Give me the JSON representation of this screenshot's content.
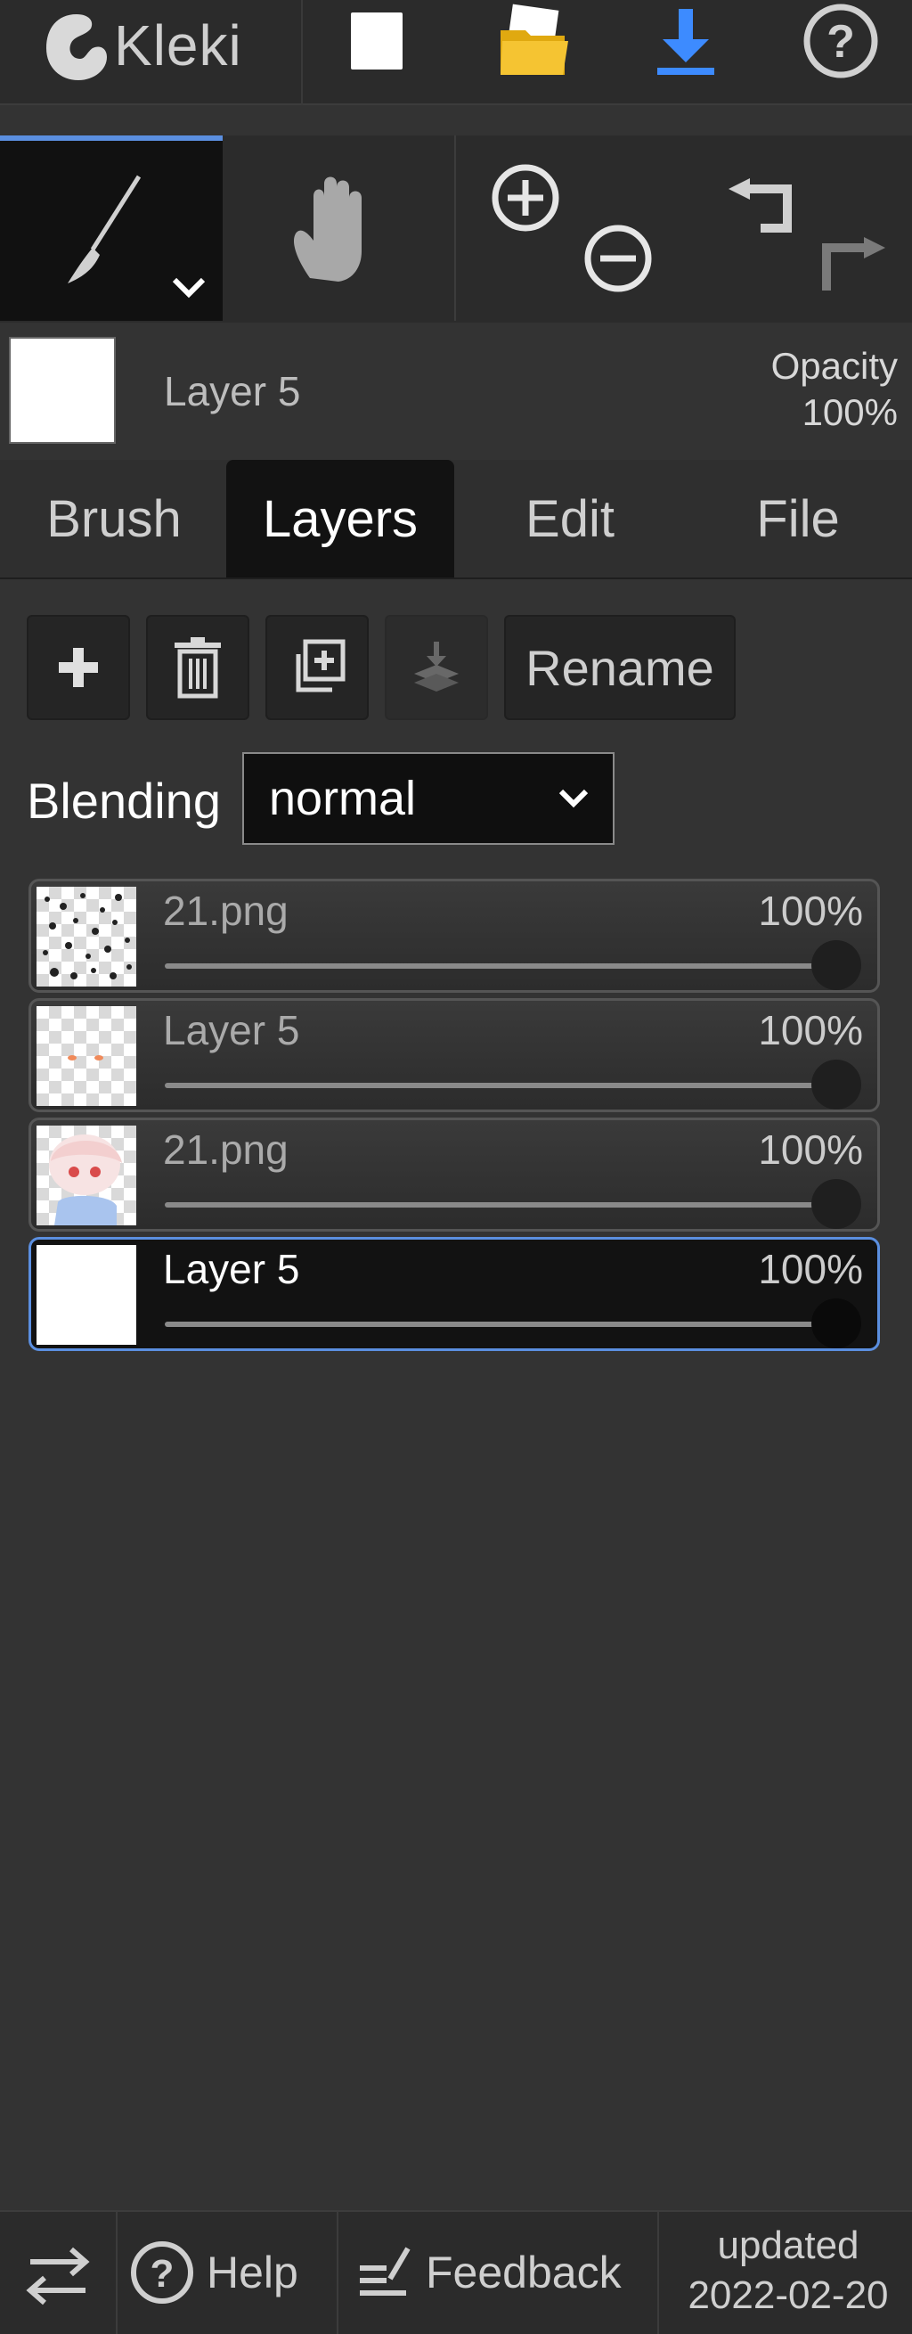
{
  "app": {
    "logo_text": "Kleki"
  },
  "preview": {
    "layer_name": "Layer 5",
    "opacity_label": "Opacity",
    "opacity_value": "100%"
  },
  "tabs": [
    "Brush",
    "Layers",
    "Edit",
    "File"
  ],
  "active_tab": "Layers",
  "layer_actions": {
    "rename_label": "Rename"
  },
  "blending": {
    "label": "Blending",
    "value": "normal"
  },
  "layers": [
    {
      "name": "21.png",
      "opacity": "100%",
      "selected": false
    },
    {
      "name": "Layer 5",
      "opacity": "100%",
      "selected": false
    },
    {
      "name": "21.png",
      "opacity": "100%",
      "selected": false
    },
    {
      "name": "Layer 5",
      "opacity": "100%",
      "selected": true
    }
  ],
  "bottom": {
    "help_label": "Help",
    "feedback_label": "Feedback",
    "updated_label": "updated",
    "updated_date": "2022-02-20"
  },
  "colors": {
    "accent": "#5b8fe0",
    "download": "#3d8bff",
    "folder": "#f2c230"
  },
  "icons": [
    "kleki-logo-icon",
    "new-image-icon",
    "open-folder-icon",
    "download-icon",
    "help-circle-icon",
    "brush-icon",
    "chevron-down-icon",
    "hand-icon",
    "zoom-in-icon",
    "zoom-out-icon",
    "undo-icon",
    "redo-icon",
    "plus-icon",
    "trash-icon",
    "duplicate-icon",
    "merge-down-icon",
    "swap-icon",
    "feedback-icon"
  ]
}
